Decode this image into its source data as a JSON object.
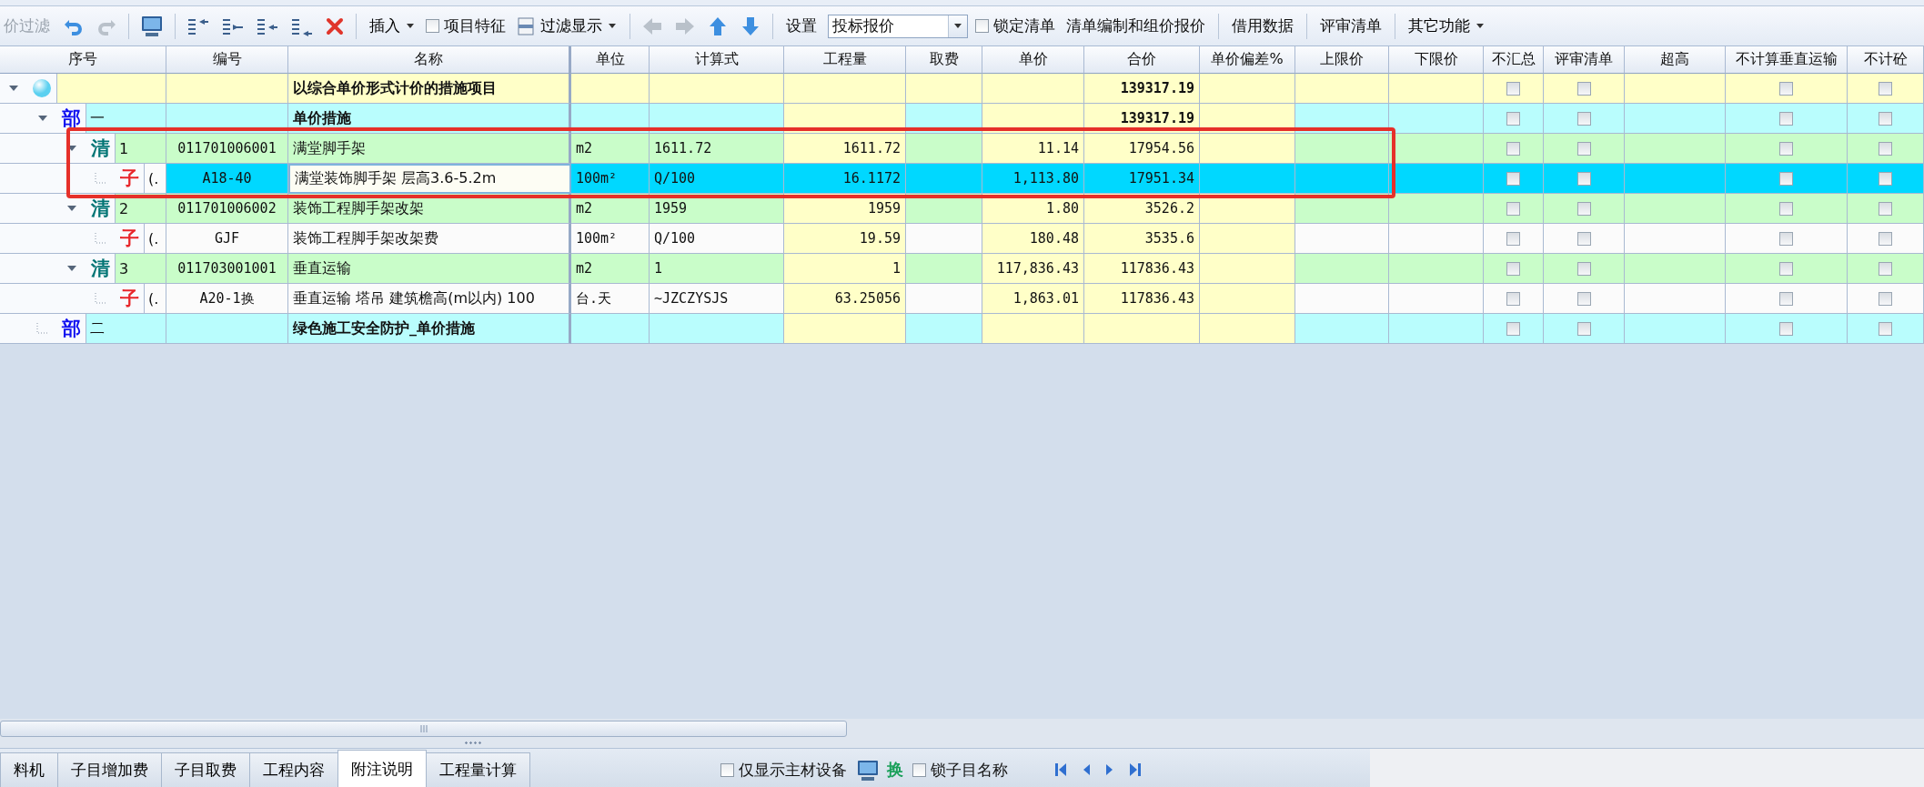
{
  "toolbar": [
    {
      "kind": "text-button",
      "label": "价过滤",
      "disabled": true
    },
    {
      "kind": "icon-button",
      "disabled": false
    },
    {
      "kind": "icon-button",
      "disabled": true
    },
    {
      "kind": "separator"
    },
    {
      "kind": "icon-button"
    },
    {
      "kind": "separator"
    },
    {
      "kind": "icon-button"
    },
    {
      "kind": "icon-button"
    },
    {
      "kind": "icon-button"
    },
    {
      "kind": "icon-button"
    },
    {
      "kind": "icon-button"
    },
    {
      "kind": "separator"
    },
    {
      "kind": "menu-button",
      "label": "插入"
    },
    {
      "kind": "checkbox",
      "label": "项目特征",
      "checked": false
    },
    {
      "kind": "icon-menu-button",
      "label": "过滤显示"
    },
    {
      "kind": "separator"
    },
    {
      "kind": "icon-button",
      "disabled": true
    },
    {
      "kind": "icon-button",
      "disabled": true
    },
    {
      "kind": "icon-button",
      "disabled": false
    },
    {
      "kind": "icon-button",
      "disabled": false
    },
    {
      "kind": "separator"
    },
    {
      "kind": "text-button",
      "label": "设置",
      "disabled": false
    },
    {
      "kind": "combo",
      "value": "投标报价"
    },
    {
      "kind": "checkbox",
      "label": "锁定清单",
      "checked": false
    },
    {
      "kind": "text-button",
      "label": "清单编制和组价报价",
      "disabled": false
    },
    {
      "kind": "separator"
    },
    {
      "kind": "text-button",
      "label": "借用数据",
      "disabled": false
    },
    {
      "kind": "separator"
    },
    {
      "kind": "text-button",
      "label": "评审清单",
      "disabled": false
    },
    {
      "kind": "separator"
    },
    {
      "kind": "menu-button",
      "label": "其它功能"
    }
  ],
  "table": {
    "columns": [
      "序号",
      "编号",
      "名称",
      "单位",
      "计算式",
      "工程量",
      "取费",
      "单价",
      "合价",
      "单价偏差%",
      "上限价",
      "下限价",
      "不汇总",
      "评审清单",
      "超高",
      "不计算垂直运输",
      "不计砼"
    ],
    "tree": [
      {
        "kind": "root",
        "expanded": true,
        "selected": false,
        "annotated": false,
        "name": "以综合单价形式计价的措施项目",
        "total": "139317.19",
        "no_summary": false,
        "review": false,
        "no_vertical": false,
        "no_hoist": false,
        "children": [
          {
            "kind": "section",
            "marker": "部",
            "seq": "一",
            "expanded": true,
            "selected": false,
            "annotated": false,
            "name": "单价措施",
            "total": "139317.19",
            "no_summary": false,
            "review": false,
            "no_vertical": false,
            "no_hoist": false,
            "children": [
              {
                "kind": "item",
                "marker": "清",
                "seq": "1",
                "expanded": true,
                "selected": false,
                "annotated": true,
                "code": "011701006001",
                "name": "满堂脚手架",
                "unit": "m2",
                "formula": "1611.72",
                "quantity": "1611.72",
                "unit_price": "11.14",
                "total": "17954.56",
                "no_summary": false,
                "review": false,
                "no_vertical": false,
                "no_hoist": false,
                "children": [
                  {
                    "kind": "sub",
                    "marker": "子",
                    "seq": "(.",
                    "selected": true,
                    "annotated": true,
                    "code": "A18-40",
                    "name": "满堂装饰脚手架 层高3.6-5.2m",
                    "unit": "100m²",
                    "formula": "Q/100",
                    "quantity": "16.1172",
                    "unit_price": "1,113.80",
                    "total": "17951.34",
                    "no_summary": false,
                    "review": false,
                    "no_vertical": false,
                    "no_hoist": false
                  }
                ]
              },
              {
                "kind": "item",
                "marker": "清",
                "seq": "2",
                "expanded": true,
                "selected": false,
                "annotated": false,
                "code": "011701006002",
                "name": "装饰工程脚手架改架",
                "unit": "m2",
                "formula": "1959",
                "quantity": "1959",
                "unit_price": "1.80",
                "total": "3526.2",
                "no_summary": false,
                "review": false,
                "no_vertical": false,
                "no_hoist": false,
                "children": [
                  {
                    "kind": "sub",
                    "marker": "子",
                    "seq": "(.",
                    "selected": false,
                    "annotated": false,
                    "code": "GJF",
                    "name": "装饰工程脚手架改架费",
                    "unit": "100m²",
                    "formula": "Q/100",
                    "quantity": "19.59",
                    "unit_price": "180.48",
                    "total": "3535.6",
                    "no_summary": false,
                    "review": false,
                    "no_vertical": false,
                    "no_hoist": false
                  }
                ]
              },
              {
                "kind": "item",
                "marker": "清",
                "seq": "3",
                "expanded": true,
                "selected": false,
                "annotated": false,
                "code": "011703001001",
                "name": "垂直运输",
                "unit": "m2",
                "formula": "1",
                "quantity": "1",
                "unit_price": "117,836.43",
                "total": "117836.43",
                "no_summary": false,
                "review": false,
                "no_vertical": false,
                "no_hoist": false,
                "children": [
                  {
                    "kind": "sub",
                    "marker": "子",
                    "seq": "(.",
                    "selected": false,
                    "annotated": false,
                    "code": "A20-1换",
                    "name": "垂直运输 塔吊 建筑檐高(m以内) 100",
                    "unit": "台.天",
                    "formula": "~JZCZYSJS",
                    "quantity": "63.25056",
                    "unit_price": "1,863.01",
                    "total": "117836.43",
                    "no_summary": false,
                    "review": false,
                    "no_vertical": false,
                    "no_hoist": false
                  }
                ]
              }
            ]
          },
          {
            "kind": "section",
            "marker": "部",
            "seq": "二",
            "selected": false,
            "annotated": false,
            "name": "绿色施工安全防护_单价措施",
            "no_summary": false,
            "review": false,
            "no_vertical": false,
            "no_hoist": false
          }
        ]
      }
    ]
  },
  "bottom_tabs": [
    {
      "label": "料机",
      "selected": false
    },
    {
      "label": "子目增加费",
      "selected": false
    },
    {
      "label": "子目取费",
      "selected": false
    },
    {
      "label": "工程内容",
      "selected": false
    },
    {
      "label": "附注说明",
      "selected": true
    },
    {
      "label": "工程量计算",
      "selected": false
    }
  ],
  "bottom_options": {
    "main_material_only": {
      "label": "仅显示主材设备",
      "checked": false
    },
    "swap_button": "换",
    "lock_name": {
      "label": "锁子目名称",
      "checked": false
    }
  }
}
